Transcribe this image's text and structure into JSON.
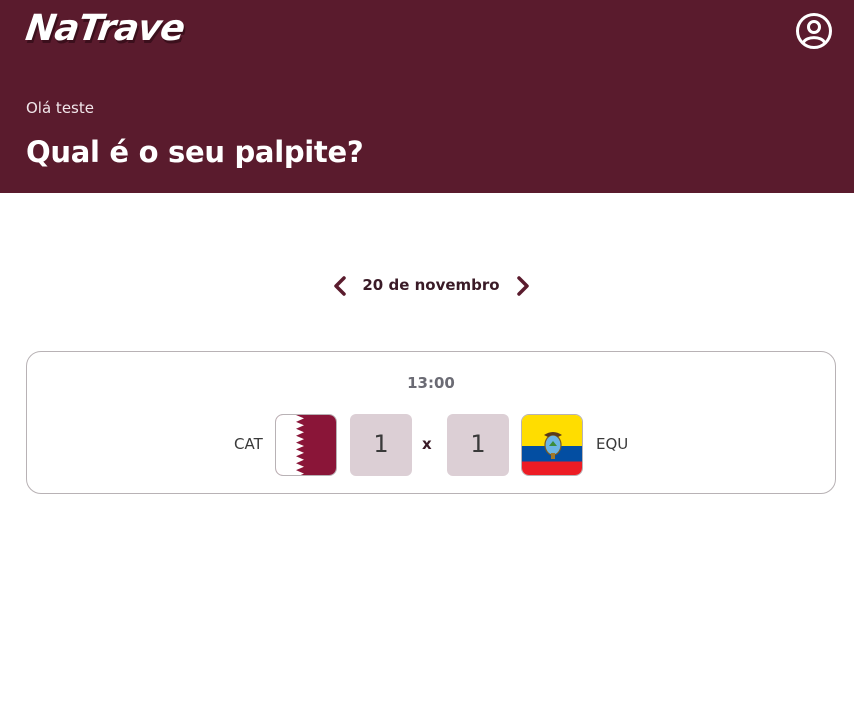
{
  "header": {
    "logo_text": "NaTrave",
    "greeting": "Olá teste",
    "headline": "Qual é o seu palpite?",
    "background_color": "#5a1b2d",
    "profile_icon": "user-circle-icon"
  },
  "date_nav": {
    "label": "20 de novembro",
    "prev_icon": "chevron-left-icon",
    "next_icon": "chevron-right-icon"
  },
  "match": {
    "time": "13:00",
    "home": {
      "code": "CAT",
      "score": "1",
      "flag": "qatar-flag-icon"
    },
    "separator": "x",
    "away": {
      "code": "EQU",
      "score": "1",
      "flag": "ecuador-flag-icon"
    }
  },
  "colors": {
    "accent": "#5a1b2d",
    "score_bg": "#dccfd5"
  }
}
